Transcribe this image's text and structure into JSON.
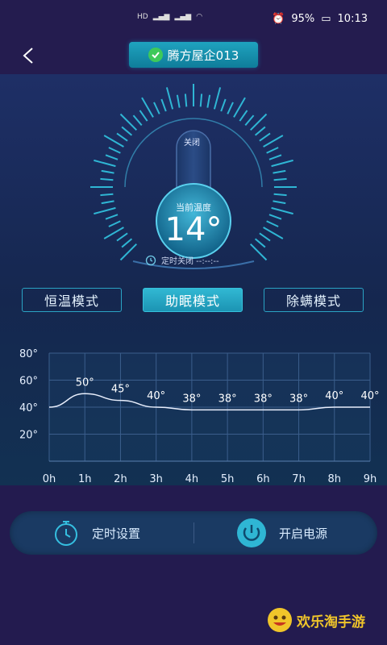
{
  "status_bar": {
    "network_left": "HD",
    "battery": "95%",
    "time": "10:13"
  },
  "header": {
    "device_name": "腾方屋企013"
  },
  "thermostat": {
    "top_label": "关闭",
    "current_label": "当前温度",
    "temperature": "14°",
    "timer_text": "定时关闭 --:--:--"
  },
  "modes": [
    {
      "label": "恒温模式",
      "active": false
    },
    {
      "label": "助眠模式",
      "active": true
    },
    {
      "label": "除螨模式",
      "active": false
    }
  ],
  "chart_data": {
    "type": "line",
    "x": [
      "0h",
      "1h",
      "2h",
      "3h",
      "4h",
      "5h",
      "6h",
      "7h",
      "8h",
      "9h"
    ],
    "y_ticks": [
      "80°",
      "60°",
      "40°",
      "20°"
    ],
    "ylim": [
      0,
      80
    ],
    "series": [
      {
        "values": [
          40,
          50,
          45,
          40,
          38,
          38,
          38,
          38,
          40,
          40
        ],
        "labels": [
          "",
          "50°",
          "45°",
          "40°",
          "38°",
          "38°",
          "38°",
          "38°",
          "40°",
          "40°"
        ]
      }
    ],
    "grid": true
  },
  "controls": {
    "timer_label": "定时设置",
    "power_label": "开启电源"
  },
  "watermark": {
    "text": "欢乐淘手游"
  },
  "colors": {
    "accent": "#2fb6d4",
    "background": "#231b4f",
    "panel": "#1a3a63"
  }
}
